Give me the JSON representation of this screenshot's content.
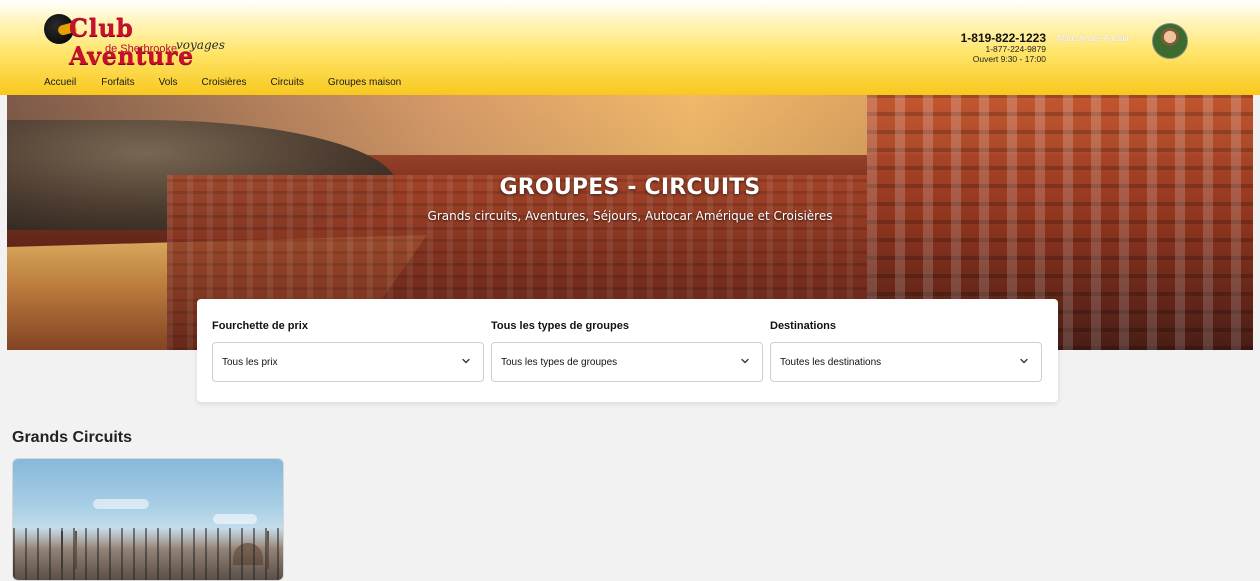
{
  "brand": {
    "name": "Club Aventure",
    "subtitle": "de Sherbrooke",
    "tagline": "voyages"
  },
  "nav": {
    "items": [
      {
        "label": "Accueil"
      },
      {
        "label": "Forfaits"
      },
      {
        "label": "Vols"
      },
      {
        "label": "Croisières"
      },
      {
        "label": "Circuits"
      },
      {
        "label": "Groupes maison"
      }
    ]
  },
  "contact": {
    "phone_main": "1-819-822-1223",
    "phone_alt": "1-877-224-9879",
    "hours": "Ouvert 9:30 - 17:00",
    "agent_name": "Marc-Andre Auclair"
  },
  "hero": {
    "title": "GROUPES - CIRCUITS",
    "subtitle": "Grands circuits, Aventures, Séjours, Autocar Amérique et Croisières"
  },
  "filters": [
    {
      "label": "Fourchette de prix",
      "value": "Tous les prix"
    },
    {
      "label": "Tous les types de groupes",
      "value": "Tous les types de groupes"
    },
    {
      "label": "Destinations",
      "value": "Toutes les destinations"
    }
  ],
  "sections": {
    "grands_circuits_title": "Grands Circuits"
  },
  "icons": {
    "dropdown": "chevron-down-icon",
    "avatar": "avatar"
  },
  "colors": {
    "brand_red": "#c8102e",
    "header_yellow": "#f8c81e"
  }
}
